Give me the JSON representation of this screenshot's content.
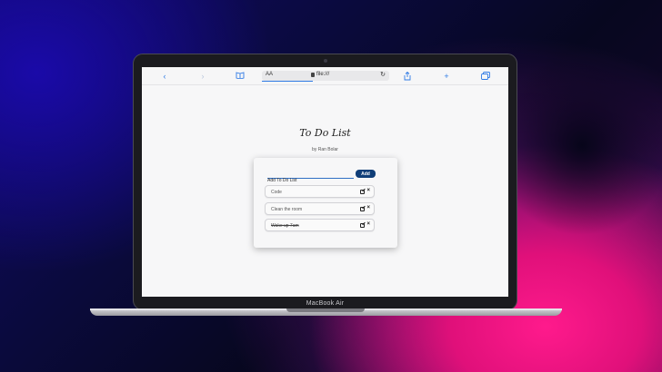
{
  "device": {
    "label": "MacBook Air"
  },
  "browser": {
    "text_size_label": "AA",
    "url": "file:///",
    "icons": [
      "chevron-left-icon",
      "chevron-right-icon",
      "book-icon",
      "lock-icon",
      "reload-icon",
      "share-icon",
      "plus-icon",
      "tabs-icon"
    ],
    "accent_color": "#2f7ae5"
  },
  "page": {
    "title": "To Do List",
    "byline": "by Ran Bolar"
  },
  "todo": {
    "input_placeholder": "Add To Do List",
    "add_label": "Add",
    "add_color": "#103e78",
    "items": [
      {
        "text": "Code",
        "done": false
      },
      {
        "text": "Clean the room",
        "done": false
      },
      {
        "text": "Wake up 7am",
        "done": true
      }
    ]
  }
}
